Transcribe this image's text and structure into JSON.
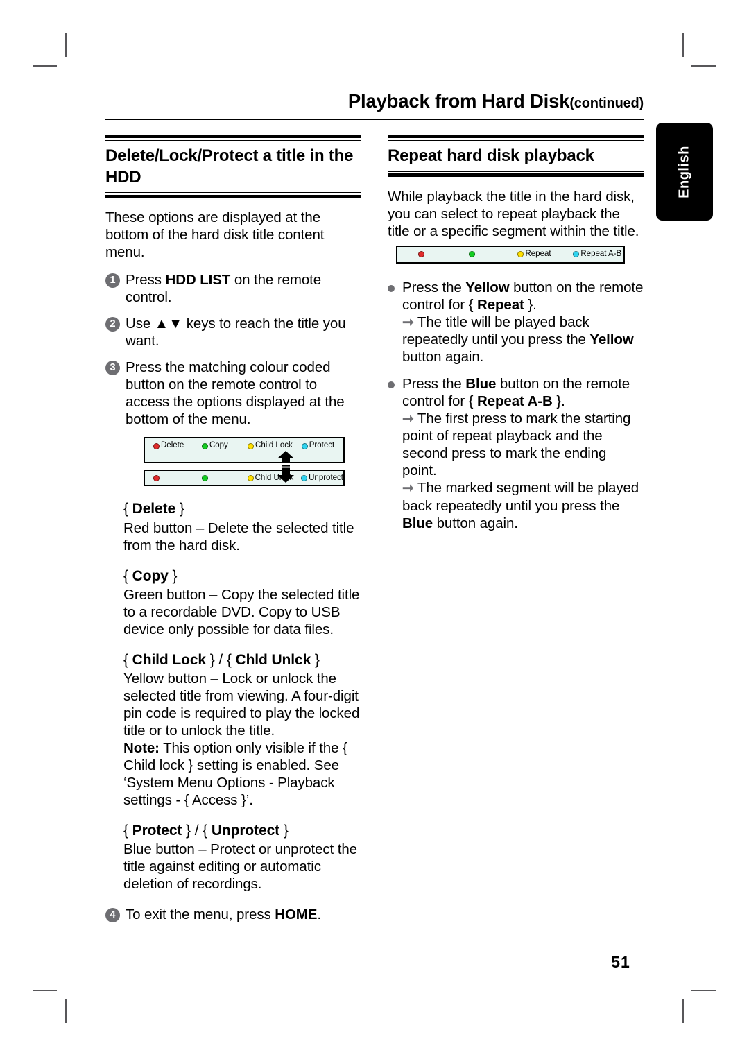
{
  "running_head": {
    "title": "Playback from Hard Disk",
    "continued": "(continued)"
  },
  "language_tab": "English",
  "page_number": "51",
  "left_column": {
    "heading": "Delete/Lock/Protect a title in the HDD",
    "intro": "These options are displayed at the bottom of the hard disk title content menu.",
    "steps": [
      {
        "number": "1",
        "text_before": "Press ",
        "bold": "HDD LIST",
        "text_after": " on the remote control."
      },
      {
        "number": "2",
        "text_before": "Use ",
        "bold": "▲▼",
        "text_after": " keys to reach the title you want."
      },
      {
        "number": "3",
        "text_before": "Press the matching colour coded button on the remote control to access the options displayed at the bottom of the menu.",
        "bold": "",
        "text_after": ""
      }
    ],
    "osd_menu": {
      "row_top": [
        {
          "colour": "red",
          "label": "Delete"
        },
        {
          "colour": "green",
          "label": "Copy"
        },
        {
          "colour": "yellow",
          "label": "Child Lock"
        },
        {
          "colour": "blue",
          "label": "Protect"
        }
      ],
      "row_bottom": [
        {
          "colour": "red",
          "label": ""
        },
        {
          "colour": "green",
          "label": ""
        },
        {
          "colour": "yellow",
          "label": "Chld Unlck"
        },
        {
          "colour": "blue",
          "label": "Unprotect"
        }
      ]
    },
    "definitions": [
      {
        "term_html": "{ <b>Delete</b> }",
        "body": "Red button – Delete the selected title from the hard disk."
      },
      {
        "term_html": "{ <b>Copy</b> }",
        "body": "Green button – Copy the selected title to a recordable DVD.  Copy to USB device only possible for data files."
      },
      {
        "term_html": "{ <b>Child Lock</b> } / { <b>Chld Unlck</b> }",
        "body": "Yellow button – Lock or unlock the selected title from viewing.  A four-digit pin code is required to play the locked title or to unlock the title.\n<b>Note:</b>  This option only visible if the { Child lock } setting is enabled.  See ‘System Menu Options - Playback settings - { Access }’."
      },
      {
        "term_html": "{ <b>Protect</b> } / { <b>Unprotect</b> }",
        "body": "Blue button – Protect or unprotect the title against editing or automatic deletion of recordings."
      }
    ],
    "final_step": {
      "number": "4",
      "text_before": "To exit the menu, press ",
      "bold": "HOME",
      "text_after": "."
    }
  },
  "right_column": {
    "heading": "Repeat hard disk playback",
    "intro": "While playback the title in the hard disk, you can select to repeat playback the title or a specific segment within the title.",
    "repeat_bar": [
      {
        "colour": "red",
        "label": ""
      },
      {
        "colour": "green",
        "label": ""
      },
      {
        "colour": "yellow",
        "label": "Repeat"
      },
      {
        "colour": "blue",
        "label": "Repeat A-B"
      }
    ],
    "bullets": [
      {
        "main_html": "Press the <b>Yellow</b> button on the remote control for { <b>Repeat</b> }.",
        "results": [
          "The title will be played back repeatedly until you press the <b>Yellow</b> button again."
        ]
      },
      {
        "main_html": "Press the <b>Blue</b> button on the remote control for { <b>Repeat A-B</b> }.",
        "results": [
          "The first press to mark the starting point of repeat playback and the second press to mark the ending point.",
          "The marked segment will be played back repeatedly until you press the <b>Blue</b> button again."
        ]
      }
    ]
  },
  "colors": {
    "red": "#e02c2c",
    "green": "#14cc22",
    "yellow": "#ffe000",
    "blue": "#2fd3ef",
    "osd_background": "#e9f5f2",
    "marker_gray": "#6e6e72"
  }
}
